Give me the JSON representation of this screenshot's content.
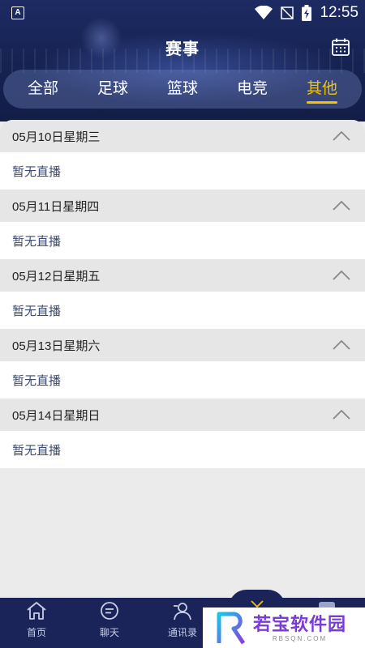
{
  "status_bar": {
    "time": "12:55",
    "app_badge": "A"
  },
  "header": {
    "title": "赛事"
  },
  "tabs": [
    {
      "label": "全部",
      "active": false
    },
    {
      "label": "足球",
      "active": false
    },
    {
      "label": "篮球",
      "active": false
    },
    {
      "label": "电竞",
      "active": false
    },
    {
      "label": "其他",
      "active": true
    }
  ],
  "days": [
    {
      "date": "05月10日星期三",
      "empty_text": "暂无直播"
    },
    {
      "date": "05月11日星期四",
      "empty_text": "暂无直播"
    },
    {
      "date": "05月12日星期五",
      "empty_text": "暂无直播"
    },
    {
      "date": "05月13日星期六",
      "empty_text": "暂无直播"
    },
    {
      "date": "05月14日星期日",
      "empty_text": "暂无直播"
    }
  ],
  "bottom_nav": [
    {
      "label": "首页",
      "icon": "home-icon"
    },
    {
      "label": "聊天",
      "icon": "chat-icon"
    },
    {
      "label": "通讯录",
      "icon": "contacts-icon"
    }
  ],
  "watermark": {
    "cn": "若宝软件园",
    "en": "RBSQN.COM"
  },
  "colors": {
    "header_bg": "#172455",
    "accent": "#f4c400",
    "nav_bg": "#1a2458"
  }
}
